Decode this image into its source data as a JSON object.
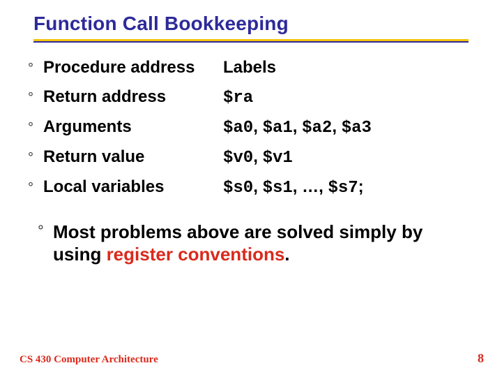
{
  "title": "Function Call Bookkeeping",
  "rows": [
    {
      "term": "Procedure address",
      "value": "Labels",
      "mono": false
    },
    {
      "term": "Return address",
      "value": "$ra",
      "mono": true
    },
    {
      "term": "Arguments",
      "value_parts": [
        "$a0",
        ", ",
        "$a1",
        ", ",
        "$a2",
        ", ",
        "$a3"
      ],
      "mono": true
    },
    {
      "term": "Return value",
      "value_parts": [
        "$v0",
        ", ",
        "$v1"
      ],
      "mono": true
    },
    {
      "term": "Local variables",
      "value_parts": [
        "$s0",
        ", ",
        "$s1",
        ", …, ",
        "$s7",
        ";"
      ],
      "mono": true
    }
  ],
  "summary": {
    "pre": "Most problems above are solved simply by using ",
    "accent": "register conventions",
    "post": "."
  },
  "footer": {
    "left": "CS 430 Computer Architecture",
    "right": "8"
  },
  "bullet_glyph": "°"
}
